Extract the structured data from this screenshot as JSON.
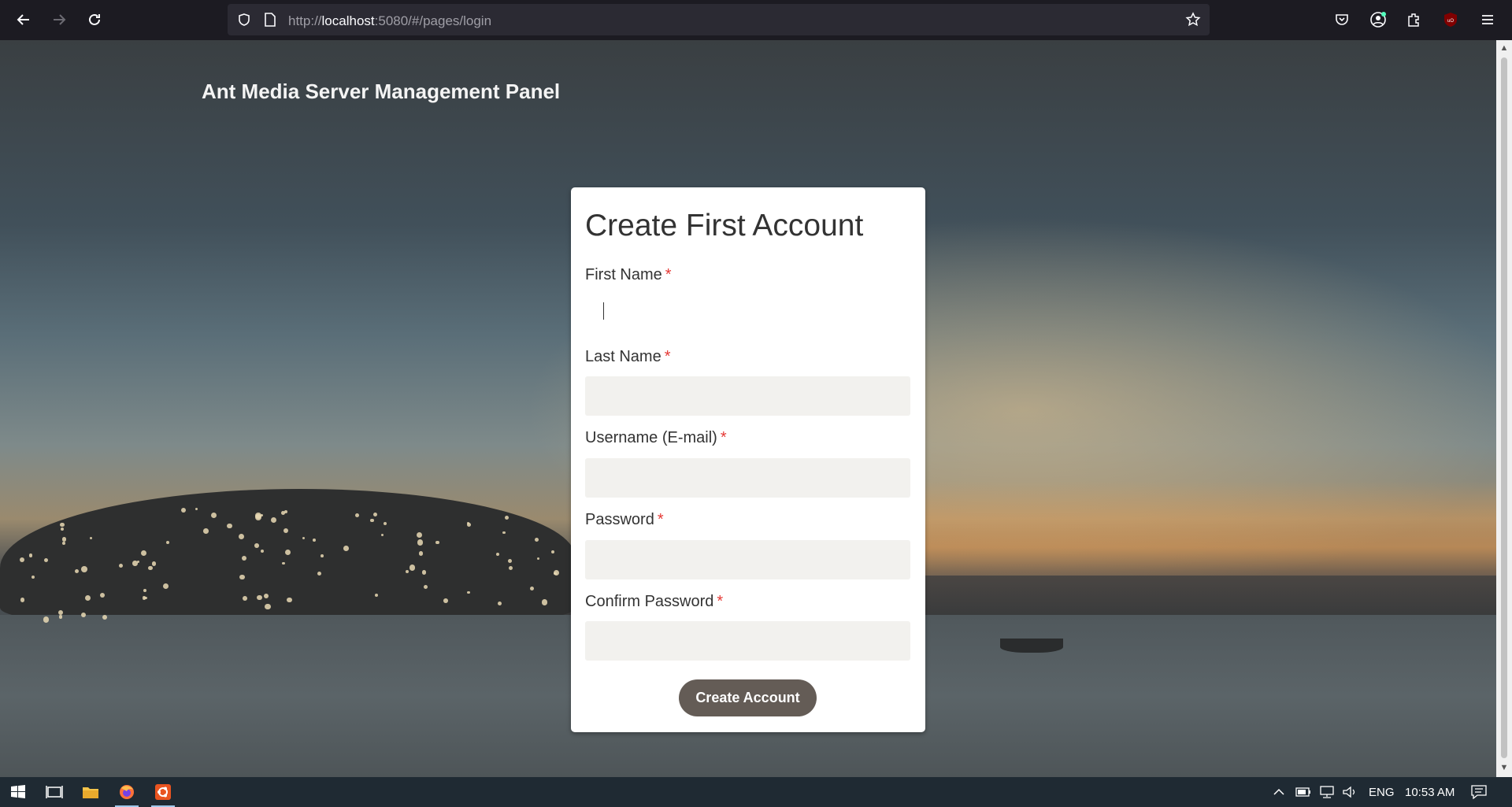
{
  "browser": {
    "url_prefix": "http://",
    "url_host": "localhost",
    "url_rest": ":5080/#/pages/login"
  },
  "page": {
    "title": "Ant Media Server Management Panel"
  },
  "form": {
    "title": "Create First Account",
    "required_mark": "*",
    "fields": [
      {
        "label": "First Name",
        "value": "",
        "placeholder": ""
      },
      {
        "label": "Last Name",
        "value": "",
        "placeholder": ""
      },
      {
        "label": "Username (E-mail)",
        "value": "",
        "placeholder": ""
      },
      {
        "label": "Password",
        "value": "",
        "placeholder": ""
      },
      {
        "label": "Confirm Password",
        "value": "",
        "placeholder": ""
      }
    ],
    "submit_label": "Create Account",
    "submit_color": "#645c56",
    "required_color": "#e53935"
  },
  "taskbar": {
    "language": "ENG",
    "time": "10:53 AM",
    "apps": [
      "windows-start-icon",
      "task-view-icon",
      "file-explorer-icon",
      "firefox-icon",
      "ubuntu-icon"
    ]
  }
}
